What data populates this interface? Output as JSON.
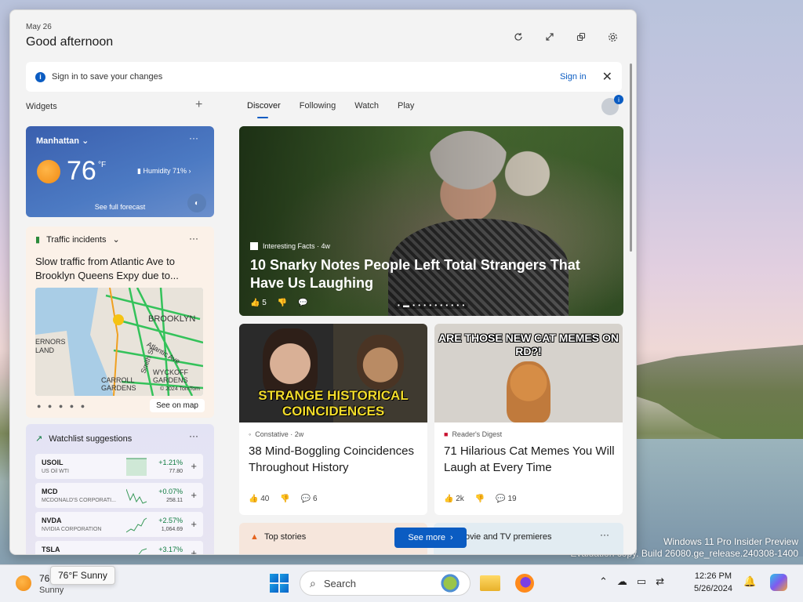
{
  "desktop": {
    "watermark_line1": "Windows 11 Pro Insider Preview",
    "watermark_line2": "Evaluation copy. Build 26080.ge_release.240308-1400"
  },
  "header": {
    "date": "May 26",
    "greeting": "Good afternoon",
    "icons": [
      "refresh-icon",
      "expand-icon",
      "share-icon",
      "gear-icon"
    ]
  },
  "signin_bar": {
    "message": "Sign in to save your changes",
    "link": "Sign in"
  },
  "widgets_label": "Widgets",
  "weather": {
    "location": "Manhattan",
    "temp": "76",
    "unit": "°F",
    "humidity": "Humidity 71%",
    "forecast_link": "See full forecast"
  },
  "traffic": {
    "title": "Traffic incidents",
    "description": "Slow traffic from Atlantic Ave to Brooklyn Queens Expy due to...",
    "map_labels": [
      "BROOKLYN",
      "ERNORS",
      "LAND",
      "CARROLL",
      "GARDENS",
      "WYCKOFF",
      "GARDENS",
      "Atlantic Ave",
      "Smith St",
      "© 2024 TomTom"
    ],
    "see_map": "See on map"
  },
  "watchlist": {
    "title": "Watchlist suggestions",
    "stocks": [
      {
        "symbol": "USOIL",
        "name": "US Oil WTI",
        "change": "+1.21%",
        "price": "77.80"
      },
      {
        "symbol": "MCD",
        "name": "MCDONALD'S CORPORATI...",
        "change": "+0.07%",
        "price": "258.11"
      },
      {
        "symbol": "NVDA",
        "name": "NVIDIA CORPORATION",
        "change": "+2.57%",
        "price": "1,064.69"
      },
      {
        "symbol": "TSLA",
        "name": "",
        "change": "+3.17%",
        "price": ""
      }
    ]
  },
  "tabs": [
    {
      "label": "Discover",
      "active": true
    },
    {
      "label": "Following"
    },
    {
      "label": "Watch"
    },
    {
      "label": "Play"
    }
  ],
  "hero": {
    "source": "Interesting Facts · 4w",
    "title": "10 Snarky Notes People Left Total Strangers That Have Us Laughing",
    "likes": "5"
  },
  "cards": [
    {
      "image_text": "STRANGE HISTORICAL COINCIDENCES",
      "source": "Constative · 2w",
      "title": "38 Mind-Boggling Coincidences Throughout History",
      "likes": "40",
      "comments": "6"
    },
    {
      "image_text": "ARE THOSE NEW CAT MEMES ON RD?!",
      "source": "Reader's Digest",
      "title": "71 Hilarious Cat Memes You Will Laugh at Every Time",
      "likes": "2k",
      "comments": "19"
    }
  ],
  "bottom": {
    "top_stories": "Top stories",
    "see_more": "See more",
    "movies": "ovie and TV premieres"
  },
  "taskbar": {
    "weather_temp": "76",
    "weather_cond": "Sunny",
    "tooltip": "76°F Sunny",
    "search_placeholder": "Search",
    "time": "12:26 PM",
    "date": "5/26/2024"
  },
  "colors": {
    "accent": "#0b5cc2",
    "positive": "#0d7a3f"
  }
}
